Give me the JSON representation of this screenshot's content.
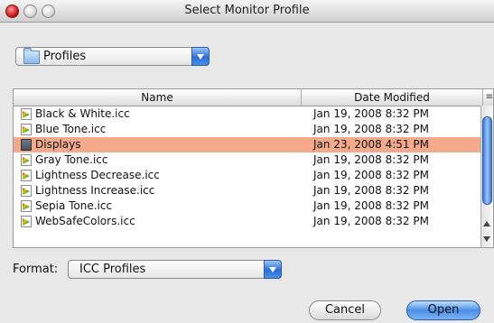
{
  "window": {
    "title": "Select Monitor Profile"
  },
  "location": {
    "selected": "Profiles",
    "icon": "folder-icon"
  },
  "table": {
    "columns": {
      "name": "Name",
      "date": "Date Modified",
      "corner": "≡"
    },
    "rows": [
      {
        "name": "Black & White.icc",
        "date": "Jan 19, 2008 8:32 PM",
        "kind": "icc-file",
        "selected": false
      },
      {
        "name": "Blue Tone.icc",
        "date": "Jan 19, 2008 8:32 PM",
        "kind": "icc-file",
        "selected": false
      },
      {
        "name": "Displays",
        "date": "Jan 23, 2008 4:51 PM",
        "kind": "folder",
        "selected": true
      },
      {
        "name": "Gray Tone.icc",
        "date": "Jan 19, 2008 8:32 PM",
        "kind": "icc-file",
        "selected": false
      },
      {
        "name": "Lightness Decrease.icc",
        "date": "Jan 19, 2008 8:32 PM",
        "kind": "icc-file",
        "selected": false
      },
      {
        "name": "Lightness Increase.icc",
        "date": "Jan 19, 2008 8:32 PM",
        "kind": "icc-file",
        "selected": false
      },
      {
        "name": "Sepia Tone.icc",
        "date": "Jan 19, 2008 8:32 PM",
        "kind": "icc-file",
        "selected": false
      },
      {
        "name": "WebSafeColors.icc",
        "date": "Jan 19, 2008 8:32 PM",
        "kind": "icc-file",
        "selected": false
      }
    ],
    "selection_color": "#f3a98a"
  },
  "format": {
    "label": "Format:",
    "selected": "ICC Profiles"
  },
  "buttons": {
    "cancel": "Cancel",
    "open": "Open"
  },
  "colors": {
    "accent": "#2a6fd8"
  }
}
